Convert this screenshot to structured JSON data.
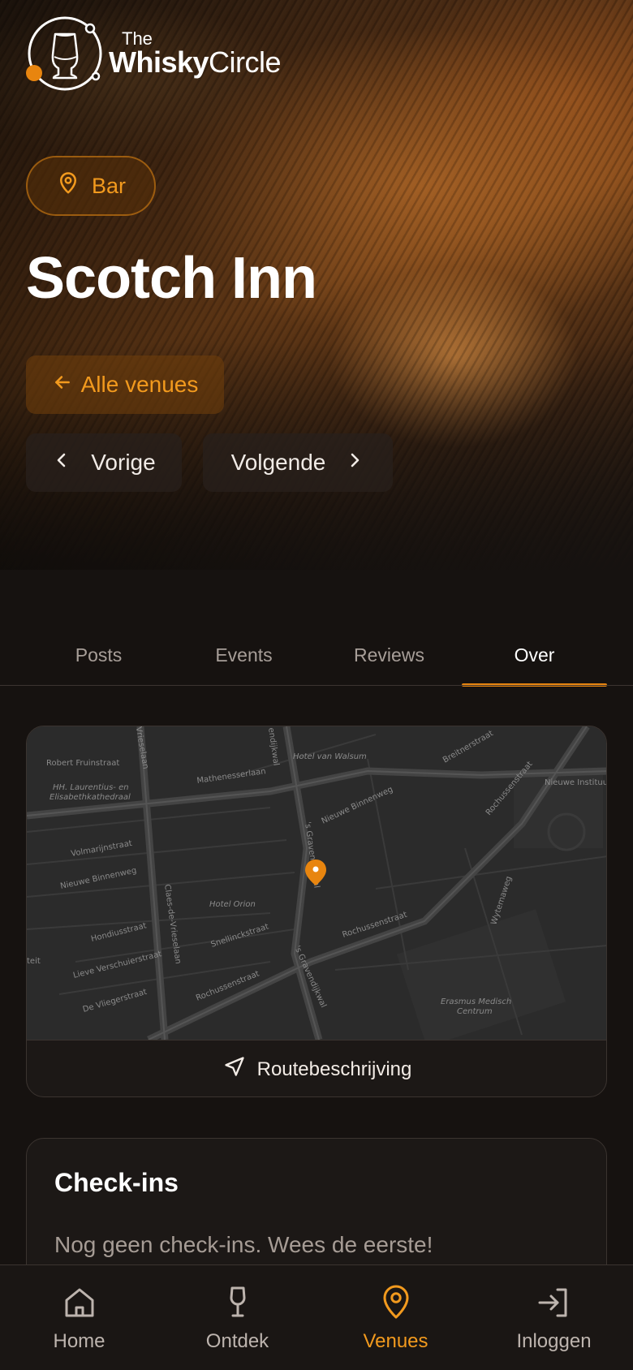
{
  "brand": {
    "the": "The",
    "whisky": "Whisky",
    "circle": "Circle"
  },
  "venue": {
    "category": "Bar",
    "name": "Scotch Inn",
    "back_label": "Alle venues",
    "prev_label": "Vorige",
    "next_label": "Volgende"
  },
  "tabs": [
    {
      "label": "Posts",
      "active": false
    },
    {
      "label": "Events",
      "active": false
    },
    {
      "label": "Reviews",
      "active": false
    },
    {
      "label": "Over",
      "active": true
    }
  ],
  "map": {
    "route_label": "Routebeschrijving",
    "labels": {
      "robert": "Robert Fruinstraat",
      "vrieselaan": "Vrieselaan",
      "mathenesser": "Mathenesserlaan",
      "laurentius1": "HH. Laurentius- en",
      "laurentius2": "Elisabethkathedraal",
      "hotel_walsum": "Hotel van Walsum",
      "breitner": "Breitnerstraat",
      "rochussen_ne": "Rochussenstraat",
      "nieuwe_instituut": "Nieuwe Instituut",
      "nieuwe_binnenweg_n": "Nieuwe Binnenweg",
      "gravendijkwal_n": "'s Gravendijkwal",
      "gravendijkwal_top": "endijkwal",
      "volmarijn": "Volmarijnstraat",
      "nieuwe_binnenweg_w": "Nieuwe Binnenweg",
      "claes": "Claes-de-Vrieselaan",
      "hotel_orion": "Hotel Orion",
      "snellinck": "Snellinckstraat",
      "rochussen_mid": "Rochussenstraat",
      "wytemaweg": "Wytemaweg",
      "hondius": "Hondiusstraat",
      "lieve": "Lieve Verschuierstraat",
      "devlieger": "De Vliegerstraat",
      "rochussen_sw": "Rochussenstraat",
      "gravendijkwal_s": "'s Gravendijkwal",
      "erasmus1": "Erasmus Medisch",
      "erasmus2": "Centrum",
      "edge": "teit"
    }
  },
  "checkins": {
    "title": "Check-ins",
    "empty": "Nog geen check-ins. Wees de eerste!"
  },
  "bottom_nav": [
    {
      "label": "Home",
      "icon": "home-icon",
      "active": false
    },
    {
      "label": "Ontdek",
      "icon": "glass-icon",
      "active": false
    },
    {
      "label": "Venues",
      "icon": "location-pin-icon",
      "active": true
    },
    {
      "label": "Inloggen",
      "icon": "login-icon",
      "active": false
    }
  ],
  "colors": {
    "accent": "#e8850f",
    "background": "#161210",
    "card": "#1c1816",
    "border": "#3b3430"
  }
}
